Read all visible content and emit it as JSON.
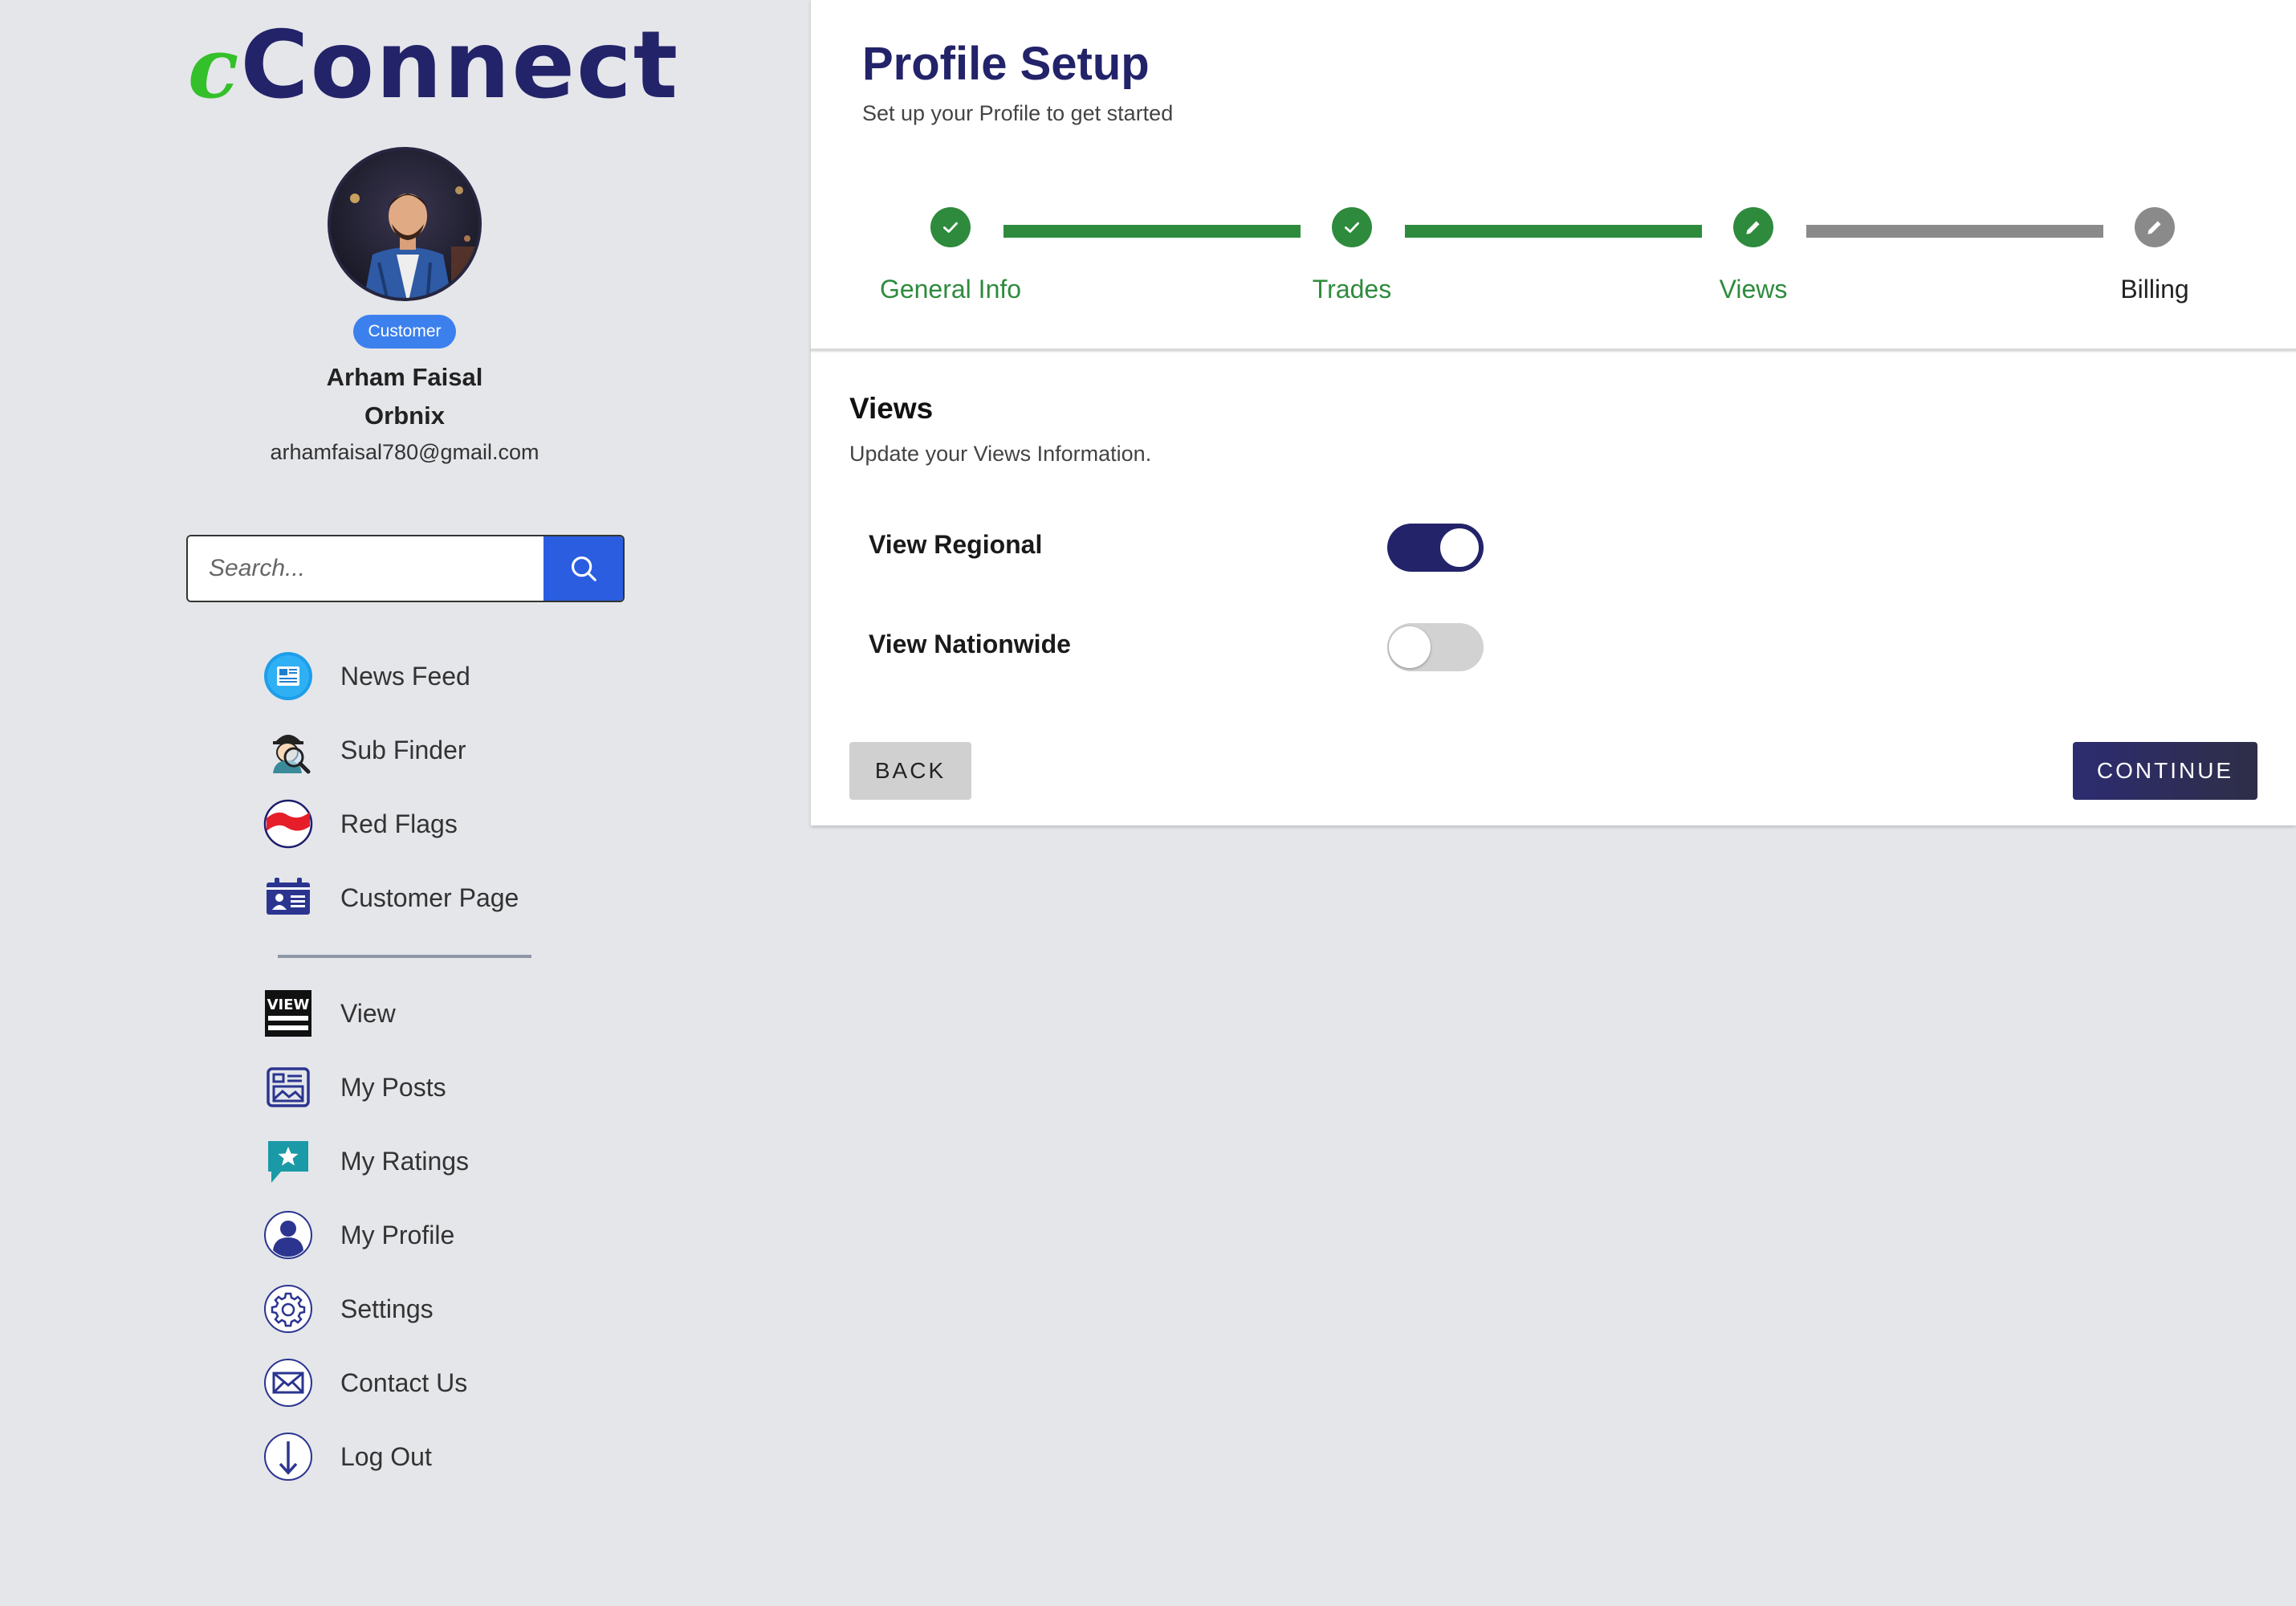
{
  "logo": {
    "c": "c",
    "rest": "Connect",
    "c_color": "#34c02a",
    "rest_color": "#23236a"
  },
  "profile": {
    "role_badge": "Customer",
    "name": "Arham Faisal",
    "organization": "Orbnix",
    "email": "arhamfaisal780@gmail.com"
  },
  "search": {
    "placeholder": "Search...",
    "value": "",
    "icon": "search-icon"
  },
  "nav_primary": [
    {
      "label": "News Feed",
      "icon": "newspaper-icon"
    },
    {
      "label": "Sub Finder",
      "icon": "detective-magnifier-icon"
    },
    {
      "label": "Red Flags",
      "icon": "red-flag-icon"
    },
    {
      "label": "Customer Page",
      "icon": "id-card-icon"
    }
  ],
  "nav_secondary": [
    {
      "label": "View",
      "icon": "view-sign-icon"
    },
    {
      "label": "My Posts",
      "icon": "posts-icon"
    },
    {
      "label": "My Ratings",
      "icon": "rating-star-icon"
    },
    {
      "label": "My Profile",
      "icon": "user-icon"
    },
    {
      "label": "Settings",
      "icon": "gear-icon"
    },
    {
      "label": "Contact Us",
      "icon": "envelope-icon"
    },
    {
      "label": "Log Out",
      "icon": "logout-arrow-icon"
    }
  ],
  "main": {
    "title": "Profile Setup",
    "subtitle": "Set up your Profile to get started",
    "steps": [
      {
        "label": "General Info",
        "state": "completed"
      },
      {
        "label": "Trades",
        "state": "completed"
      },
      {
        "label": "Views",
        "state": "active"
      },
      {
        "label": "Billing",
        "state": "pending"
      }
    ],
    "section_title": "Views",
    "section_description": "Update your Views Information.",
    "toggles": [
      {
        "label": "View Regional",
        "on": true
      },
      {
        "label": "View Nationwide",
        "on": false
      }
    ],
    "back_label": "BACK",
    "continue_label": "CONTINUE"
  },
  "colors": {
    "background": "#e5e6ea",
    "step_complete": "#2e8b3d",
    "step_pending": "#8a8a8a",
    "primary_navy": "#23236a",
    "search_button": "#2a5de0",
    "badge": "#3c80ee",
    "toggle_on": "#23236a",
    "toggle_off": "#d2d2d2"
  }
}
